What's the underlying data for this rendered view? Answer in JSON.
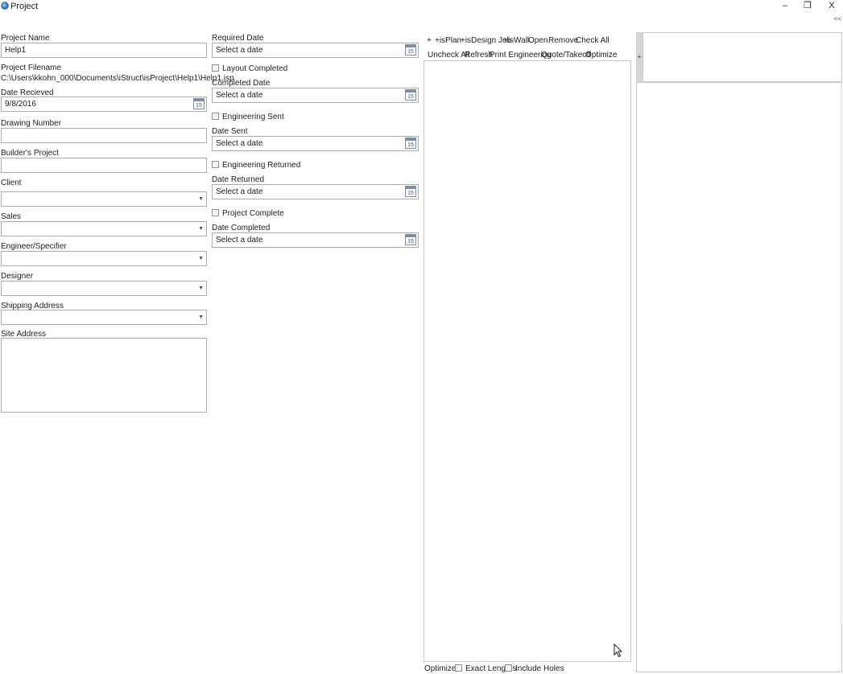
{
  "window": {
    "title": "Project",
    "minimize": "–",
    "restore": "❐",
    "close": "X",
    "collapse": "<<"
  },
  "form": {
    "project_name_label": "Project Name",
    "project_name_value": "Help1",
    "project_filename_label": "Project Filename",
    "project_filename_value": "C:\\Users\\kkohn_000\\Documents\\iStruct\\isProject\\Help1\\Help1.isp",
    "date_received_label": "Date Recieved",
    "date_received_value": "9/8/2016",
    "drawing_number_label": "Drawing Number",
    "builders_project_label": "Builder's Project",
    "client_label": "Client",
    "sales_label": "Sales",
    "engineer_label": "Engineer/Specifier",
    "designer_label": "Designer",
    "shipping_address_label": "Shipping Address",
    "site_address_label": "Site Address"
  },
  "dates": {
    "placeholder": "Select a date",
    "calendar_day": "15",
    "required_date_label": "Required Date",
    "layout_completed_label": "Layout Completed",
    "completed_date_label": "Completed Date",
    "engineering_sent_label": "Engineering Sent",
    "date_sent_label": "Date Sent",
    "engineering_returned_label": "Engineering Returned",
    "date_returned_label": "Date Returned",
    "project_complete_label": "Project Complete",
    "date_completed_label": "Date Completed"
  },
  "toolbar": {
    "row1": [
      "+",
      "+isPlan",
      "+isDesign Job",
      "+isWall",
      "Open",
      "Remove",
      "Check All"
    ],
    "row2": [
      "Uncheck All",
      "Refresh",
      "Print Engineering",
      "Quote/Takeoff",
      "Optimize"
    ]
  },
  "bottom": {
    "optimizer_label": "Optimizer",
    "exact_lengths_label": "Exact Lengths",
    "include_holes_label": "Include Holes"
  },
  "right_panel": {
    "expand_label": "+"
  }
}
